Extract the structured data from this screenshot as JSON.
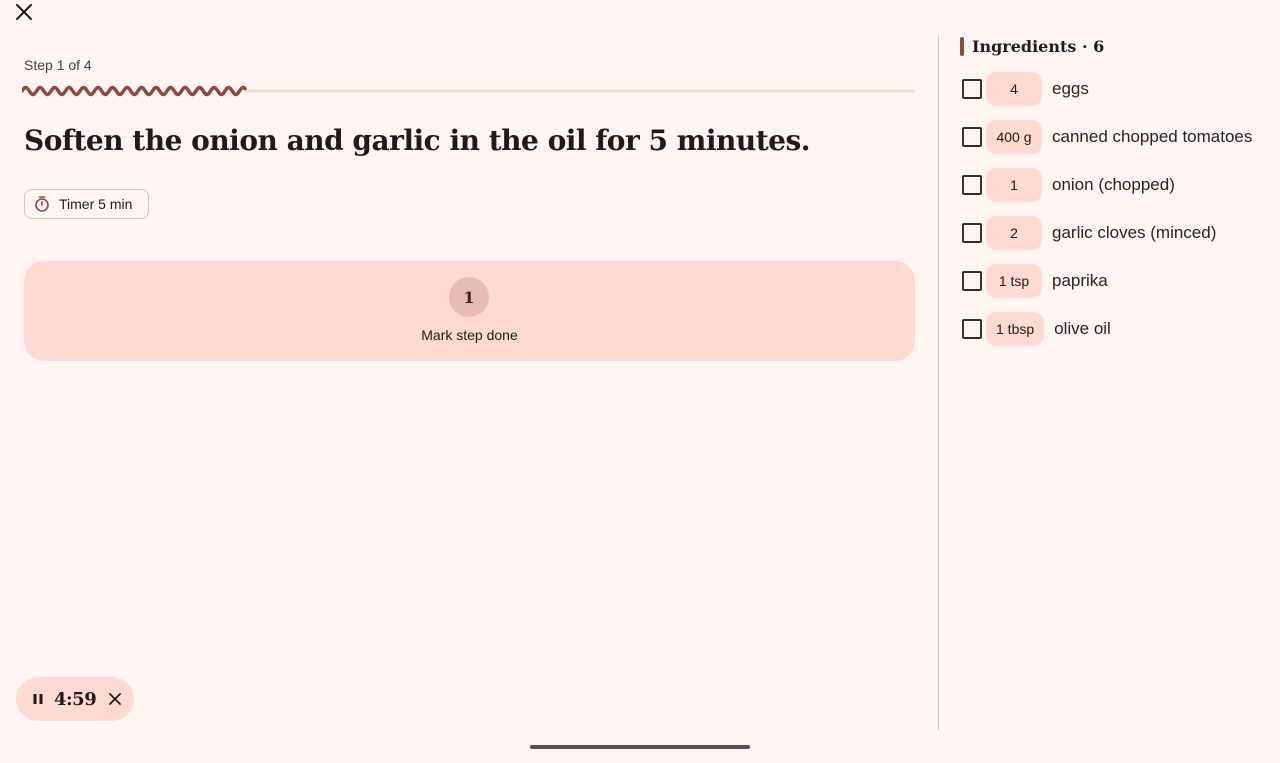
{
  "step": {
    "label": "Step 1 of 4",
    "current": 1,
    "total": 4,
    "instruction": "Soften the onion and garlic in the oil for 5 minutes."
  },
  "timer_chip": {
    "label": "Timer 5 min"
  },
  "done_card": {
    "number": "1",
    "label": "Mark step done"
  },
  "mini_timer": {
    "time": "4:59"
  },
  "ingredients": {
    "title": "Ingredients · 6",
    "items": [
      {
        "qty": "4",
        "name": "eggs",
        "checked": false
      },
      {
        "qty": "400 g",
        "name": "canned chopped tomatoes",
        "checked": false
      },
      {
        "qty": "1",
        "name": "onion (chopped)",
        "checked": false
      },
      {
        "qty": "2",
        "name": "garlic cloves (minced)",
        "checked": false
      },
      {
        "qty": "1 tsp",
        "name": "paprika",
        "checked": false
      },
      {
        "qty": "1 tbsp",
        "name": "olive oil",
        "checked": false
      }
    ]
  },
  "colors": {
    "background": "#fff6f3",
    "accent": "#8e4a3f",
    "container": "#ffdad3",
    "track": "#f0d8d3"
  },
  "icons": {
    "close": "close-icon",
    "timer": "stopwatch-icon",
    "pause": "pause-icon",
    "dismiss": "close-icon"
  }
}
